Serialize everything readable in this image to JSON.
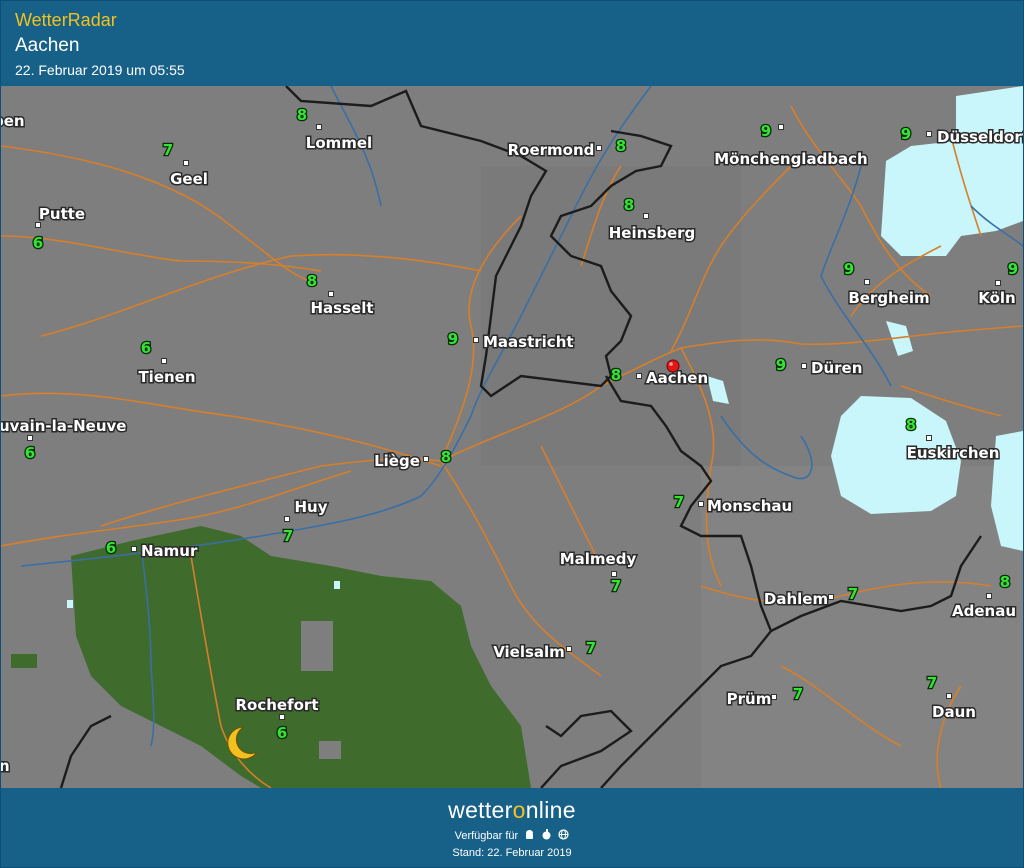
{
  "header": {
    "app_title": "WetterRadar",
    "location": "Aachen",
    "timestamp": "22. Februar 2019 um 05:55"
  },
  "map": {
    "cities": [
      {
        "name": "pen",
        "temp": ""
      },
      {
        "name": "Lommel",
        "temp": "8"
      },
      {
        "name": "Roermond",
        "temp": "8"
      },
      {
        "name": "Mönchengladbach",
        "temp": "9"
      },
      {
        "name": "Düsseldorf",
        "temp": "9"
      },
      {
        "name": "Geel",
        "temp": "7"
      },
      {
        "name": "Putte",
        "temp": "6"
      },
      {
        "name": "Heinsberg",
        "temp": "8"
      },
      {
        "name": "Hasselt",
        "temp": "8"
      },
      {
        "name": "Bergheim",
        "temp": "9"
      },
      {
        "name": "Köln",
        "temp": "9"
      },
      {
        "name": "Maastricht",
        "temp": "9"
      },
      {
        "name": "Tienen",
        "temp": "6"
      },
      {
        "name": "Aachen",
        "temp": "8"
      },
      {
        "name": "Düren",
        "temp": "9"
      },
      {
        "name": "uvain-la-Neuve",
        "temp": "6"
      },
      {
        "name": "Liège",
        "temp": "8"
      },
      {
        "name": "Euskirchen",
        "temp": "8"
      },
      {
        "name": "Huy",
        "temp": "7"
      },
      {
        "name": "Monschau",
        "temp": "7"
      },
      {
        "name": "Namur",
        "temp": "6"
      },
      {
        "name": "Malmedy",
        "temp": "7"
      },
      {
        "name": "Dahlem",
        "temp": "7"
      },
      {
        "name": "Adenau",
        "temp": "8"
      },
      {
        "name": "Vielsalm",
        "temp": "7"
      },
      {
        "name": "Prüm",
        "temp": "7"
      },
      {
        "name": "Daun",
        "temp": "7"
      },
      {
        "name": "Rochefort",
        "temp": "6"
      },
      {
        "name": "n",
        "temp": ""
      }
    ],
    "weather_icon": "moon-icon",
    "marker_icon": "location-pin-icon",
    "colors": {
      "background": "#7f7f7f",
      "rain_area": "#3f6b2d",
      "snow_area": "#c8f6fb",
      "border": "#1c1c1c",
      "road": "#d77f2a",
      "river": "#3a6fa6"
    }
  },
  "footer": {
    "brand_prefix": "wetter",
    "brand_o": "o",
    "brand_suffix": "nline",
    "available_text": "Verfügbar für",
    "platform_icons": [
      "android-icon",
      "apple-icon",
      "web-icon"
    ],
    "stand_text": "Stand: 22. Februar 2019"
  }
}
